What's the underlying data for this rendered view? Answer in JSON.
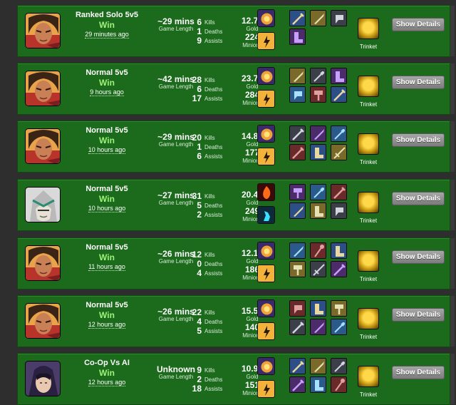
{
  "labels": {
    "game_length": "Game Length",
    "kills": "Kills",
    "deaths": "Deaths",
    "assists": "Assists",
    "gold": "Gold",
    "minions": "Minions",
    "trinket": "Trinket",
    "show_details": "Show Details"
  },
  "colors": {
    "row_bg": "#1c6a1c",
    "win_text": "#9ff27a",
    "page_bg": "#2e2e2e"
  },
  "matches": [
    {
      "champion_icon": "champion-portrait-sivir",
      "mode": "Ranked Solo 5v5",
      "result": "Win",
      "time_ago": "29 minutes ago",
      "length": "~29 mins",
      "kills": "6",
      "deaths": "1",
      "assists": "9",
      "gold": "12.7k",
      "minions": "224",
      "spells": [
        "spell-heal-icon",
        "spell-flash-icon"
      ],
      "items": [
        "sword-icon",
        "blade-icon",
        "cleaver-icon",
        "boots-icon"
      ]
    },
    {
      "champion_icon": "champion-portrait-sivir",
      "mode": "Normal 5v5",
      "result": "Win",
      "time_ago": "9 hours ago",
      "length": "~42 mins",
      "kills": "28",
      "deaths": "6",
      "assists": "17",
      "gold": "23.7k",
      "minions": "284",
      "spells": [
        "spell-heal-icon",
        "spell-flash-icon"
      ],
      "items": [
        "blade-icon",
        "dagger-icon",
        "boots-icon",
        "cleaver-icon",
        "hammer-icon",
        "sword-icon"
      ]
    },
    {
      "champion_icon": "champion-portrait-sivir",
      "mode": "Normal 5v5",
      "result": "Win",
      "time_ago": "10 hours ago",
      "length": "~29 mins",
      "kills": "20",
      "deaths": "1",
      "assists": "6",
      "gold": "14.8k",
      "minions": "177",
      "spells": [
        "spell-heal-icon",
        "spell-flash-icon"
      ],
      "items": [
        "sword-icon",
        "blade-icon",
        "dagger-icon",
        "sword-icon",
        "boots-icon",
        "longsword-icon"
      ]
    },
    {
      "champion_icon": "champion-portrait-armored",
      "mode": "Normal 5v5",
      "result": "Win",
      "time_ago": "10 hours ago",
      "length": "~27 mins",
      "kills": "31",
      "deaths": "5",
      "assists": "2",
      "gold": "20.4k",
      "minions": "249",
      "spells": [
        "spell-ignite-icon",
        "spell-ghost-icon"
      ],
      "items": [
        "hammer-icon",
        "dagger-icon",
        "sword-icon",
        "blade-icon",
        "boots-icon",
        "cleaver-icon"
      ]
    },
    {
      "champion_icon": "champion-portrait-sivir",
      "mode": "Normal 5v5",
      "result": "Win",
      "time_ago": "11 hours ago",
      "length": "~26 mins",
      "kills": "12",
      "deaths": "0",
      "assists": "4",
      "gold": "12.1k",
      "minions": "186",
      "spells": [
        "spell-heal-icon",
        "spell-flash-icon"
      ],
      "items": [
        "blade-icon",
        "staff-icon",
        "boots-icon",
        "hammer-icon",
        "longsword-icon",
        "sword-icon"
      ]
    },
    {
      "champion_icon": "champion-portrait-sivir",
      "mode": "Normal 5v5",
      "result": "Win",
      "time_ago": "12 hours ago",
      "length": "~26 mins",
      "kills": "22",
      "deaths": "4",
      "assists": "5",
      "gold": "15.5k",
      "minions": "140",
      "spells": [
        "spell-heal-icon",
        "spell-flash-icon"
      ],
      "items": [
        "cleaver-icon",
        "boots-icon",
        "hammer-icon",
        "sword-icon",
        "blade-icon",
        "dagger-icon"
      ]
    },
    {
      "champion_icon": "champion-portrait-hooded",
      "mode": "Co-Op Vs AI",
      "result": "Win",
      "time_ago": "12 hours ago",
      "length": "Unknown",
      "kills": "9",
      "deaths": "2",
      "assists": "18",
      "gold": "10.9k",
      "minions": "151",
      "spells": [
        "spell-heal-icon",
        "spell-flash-icon"
      ],
      "items": [
        "sword-icon",
        "blade-icon",
        "dagger-icon",
        "sword-icon",
        "boots-icon",
        "staff-icon"
      ]
    }
  ]
}
